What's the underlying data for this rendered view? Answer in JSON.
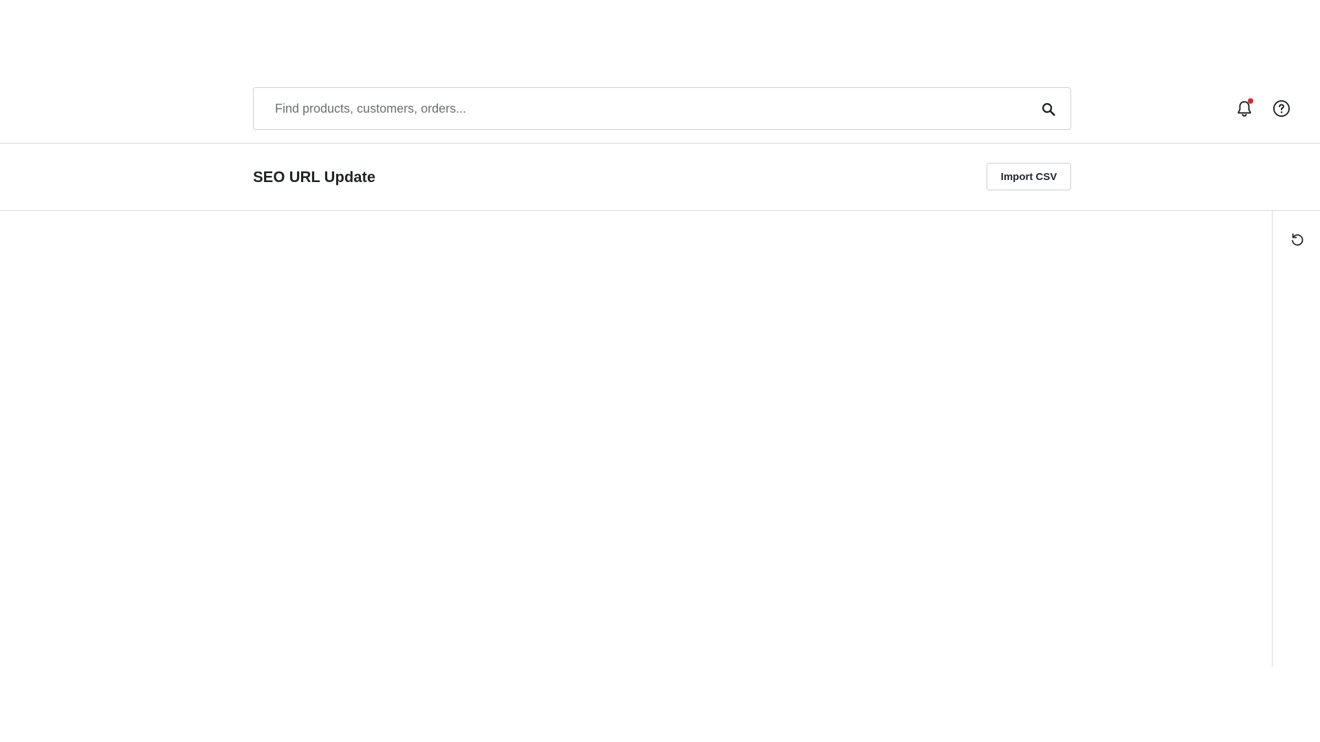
{
  "header": {
    "search": {
      "placeholder": "Find products, customers, orders...",
      "value": "",
      "icon": "search-icon"
    },
    "notifications": {
      "icon": "bell-icon",
      "has_unread": true,
      "badge_color": "#e0262f"
    },
    "help": {
      "icon": "help-circle-icon"
    }
  },
  "page": {
    "title": "SEO URL Update",
    "import_button_label": "Import CSV"
  },
  "sidebar_right": {
    "reset_icon": "reset-icon"
  }
}
